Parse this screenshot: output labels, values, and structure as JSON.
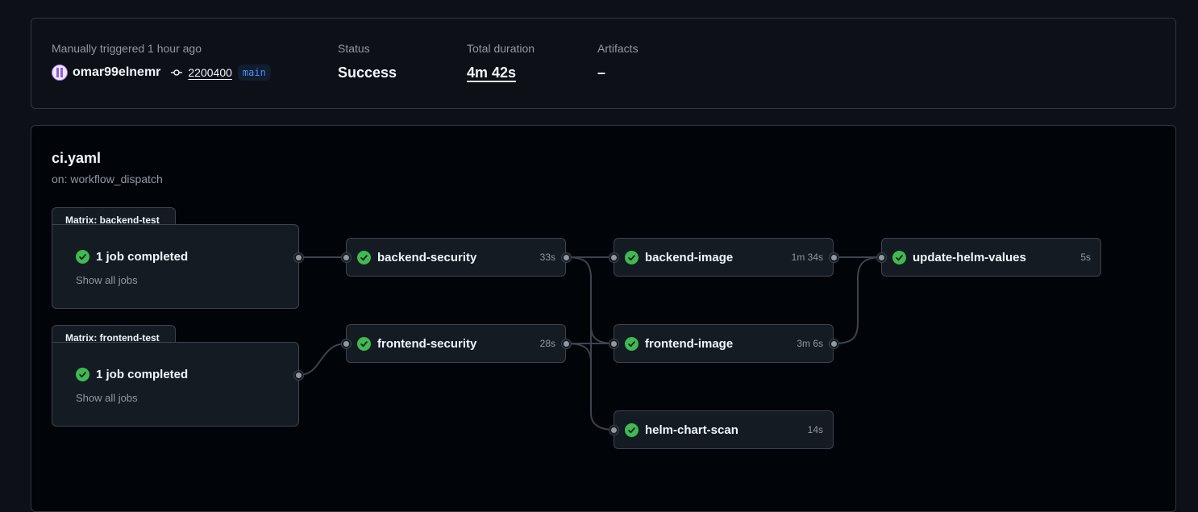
{
  "summary": {
    "trigger_label": "Manually triggered 1 hour ago",
    "actor": "omar99elnemr",
    "commit_sha": "2200400",
    "branch": "main",
    "status_label": "Status",
    "status_value": "Success",
    "duration_label": "Total duration",
    "duration_value": "4m 42s",
    "artifacts_label": "Artifacts",
    "artifacts_value": "–"
  },
  "workflow": {
    "title": "ci.yaml",
    "trigger": "on: workflow_dispatch"
  },
  "matrices": [
    {
      "title": "Matrix: backend-test",
      "status": "1 job completed",
      "link": "Show all jobs"
    },
    {
      "title": "Matrix: frontend-test",
      "status": "1 job completed",
      "link": "Show all jobs"
    }
  ],
  "jobs": [
    {
      "name": "backend-security",
      "duration": "33s",
      "status": "success"
    },
    {
      "name": "frontend-security",
      "duration": "28s",
      "status": "success"
    },
    {
      "name": "backend-image",
      "duration": "1m 34s",
      "status": "success"
    },
    {
      "name": "frontend-image",
      "duration": "3m 6s",
      "status": "success"
    },
    {
      "name": "helm-chart-scan",
      "duration": "14s",
      "status": "success"
    },
    {
      "name": "update-helm-values",
      "duration": "5s",
      "status": "success"
    }
  ],
  "colors": {
    "success": "#3fb950",
    "link": "#4493f8",
    "background": "#0d1117",
    "canvas": "#010409",
    "border": "#3d444d"
  }
}
